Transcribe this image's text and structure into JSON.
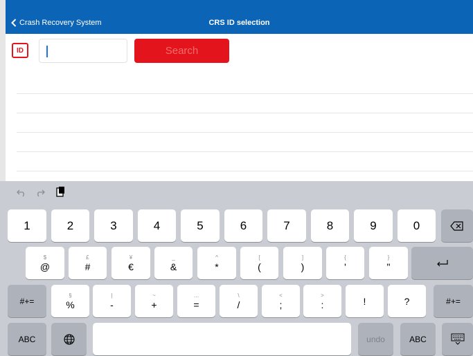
{
  "nav": {
    "back_label": "Crash Recovery System",
    "title": "CRS ID selection"
  },
  "form": {
    "id_label": "ID",
    "id_value": "",
    "search_label": "Search"
  },
  "toolbar": {
    "undo_icon": "undo-arrow",
    "redo_icon": "redo-arrow",
    "paste_icon": "clipboard"
  },
  "keyboard": {
    "row1": [
      "1",
      "2",
      "3",
      "4",
      "5",
      "6",
      "7",
      "8",
      "9",
      "0"
    ],
    "row2": [
      {
        "sup": "$",
        "main": "@"
      },
      {
        "sup": "£",
        "main": "#"
      },
      {
        "sup": "¥",
        "main": "€"
      },
      {
        "sup": "_",
        "main": "&"
      },
      {
        "sup": "^",
        "main": "*"
      },
      {
        "sup": "[",
        "main": "("
      },
      {
        "sup": "]",
        "main": ")"
      },
      {
        "sup": "{",
        "main": "'"
      },
      {
        "sup": "}",
        "main": "\""
      }
    ],
    "row3": [
      {
        "sup": "§",
        "main": "%"
      },
      {
        "sup": "|",
        "main": "-"
      },
      {
        "sup": "~",
        "main": "+"
      },
      {
        "sup": "…",
        "main": "="
      },
      {
        "sup": "\\",
        "main": "/"
      },
      {
        "sup": "<",
        "main": ";"
      },
      {
        "sup": ">",
        "main": ":"
      },
      {
        "sup": "",
        "main": "!"
      },
      {
        "sup": "",
        "main": "?"
      }
    ],
    "shift_left": "#+=",
    "shift_right": "#+=",
    "abc_left": "ABC",
    "undo_label": "undo",
    "abc_right": "ABC"
  }
}
